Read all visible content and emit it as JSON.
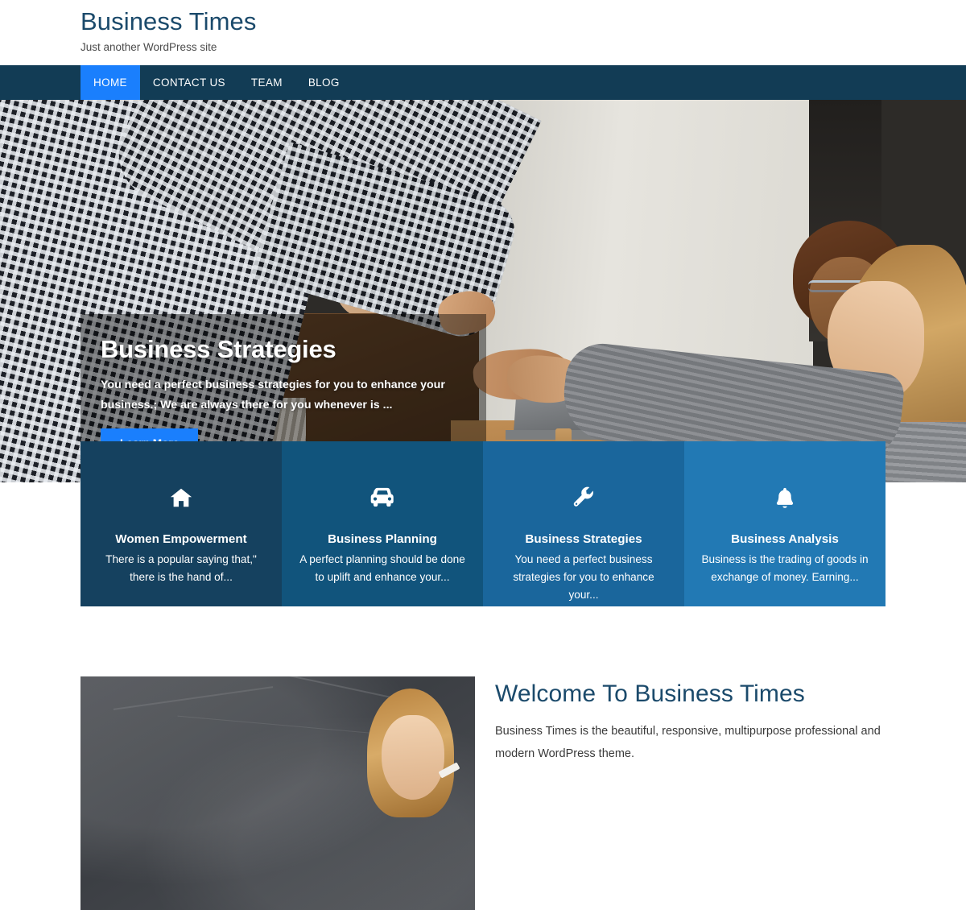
{
  "header": {
    "site_title": "Business Times",
    "tagline": "Just another WordPress site"
  },
  "nav": {
    "items": [
      {
        "label": "HOME",
        "active": true
      },
      {
        "label": "CONTACT US",
        "active": false
      },
      {
        "label": "TEAM",
        "active": false
      },
      {
        "label": "BLOG",
        "active": false
      }
    ]
  },
  "hero": {
    "title": "Business Strategies",
    "description": "You need a perfect business strategies for you to enhance your business.; We are always there for you whenever is ...",
    "button_label": "Learn More"
  },
  "features": [
    {
      "icon": "home-icon",
      "title": "Women Empowerment",
      "text": "There is a popular saying that,\" there is the hand of...",
      "color": "#15415f"
    },
    {
      "icon": "car-icon",
      "title": "Business Planning",
      "text": "A perfect planning should be done to uplift and enhance your...",
      "color": "#11547c"
    },
    {
      "icon": "wrench-icon",
      "title": "Business Strategies",
      "text": "You need a perfect business strategies for you to enhance your...",
      "color": "#1a669c"
    },
    {
      "icon": "bell-icon",
      "title": "Business Analysis",
      "text": "Business is the trading of goods in exchange of money. Earning...",
      "color": "#2279b4"
    }
  ],
  "welcome": {
    "title": "Welcome To Business Times",
    "text": "Business Times is the beautiful, responsive, multipurpose professional and modern WordPress theme."
  },
  "colors": {
    "brand_navy": "#123c55",
    "accent_blue": "#1a7ffd",
    "heading_blue": "#1b4a6b"
  }
}
